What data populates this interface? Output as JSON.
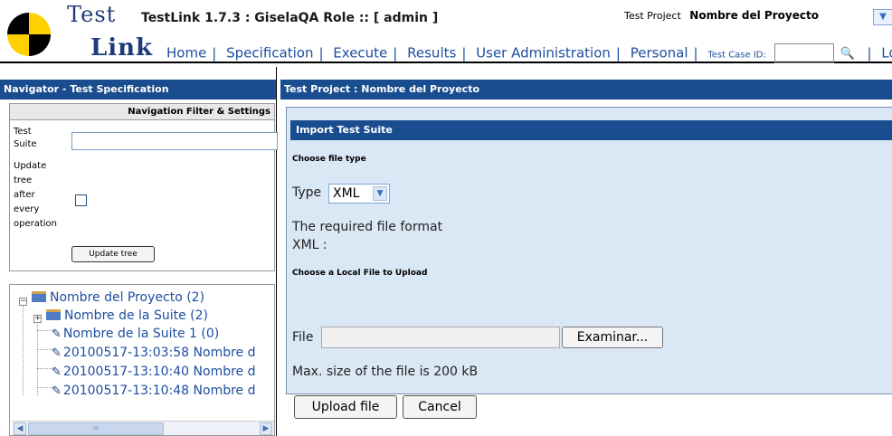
{
  "header": {
    "logo_word1": "Test",
    "logo_word2": "Link",
    "app_title": "TestLink 1.7.3 : GiselaQA Role :: [ admin ]",
    "test_project_label": "Test Project",
    "test_project_value": "Nombre del Proyecto"
  },
  "menu": {
    "items": [
      "Home",
      "Specification",
      "Execute",
      "Results",
      "User Administration",
      "Personal"
    ],
    "test_case_id_label": "Test Case ID:",
    "test_case_id_value": "",
    "logout": "Logout"
  },
  "navigator": {
    "title": "Navigator - Test Specification",
    "filter_title": "Navigation Filter & Settings",
    "test_suite_label": [
      "Test",
      "Suite"
    ],
    "test_suite_value": "",
    "update_label": [
      "Update",
      "tree",
      "after",
      "every",
      "operation"
    ],
    "update_checked": false,
    "update_button": "Update tree",
    "tree": [
      {
        "label": "Nombre del Proyecto (2)",
        "icon": "project-icon"
      },
      {
        "label": "Nombre de la Suite (2)",
        "icon": "folder-icon"
      },
      {
        "label": "Nombre de la Suite 1 (0)",
        "icon": "testcase-icon"
      },
      {
        "label": "20100517-13:03:58 Nombre d",
        "icon": "testcase-icon"
      },
      {
        "label": "20100517-13:10:40 Nombre d",
        "icon": "testcase-icon"
      },
      {
        "label": "20100517-13:10:48 Nombre d",
        "icon": "testcase-icon"
      }
    ],
    "scroll_thumb_label": "III"
  },
  "workframe": {
    "title": "Test Project : Nombre del Proyecto",
    "panel_title": "Import Test Suite",
    "choose_file_type": "Choose file type",
    "type_label": "Type",
    "type_value": "XML",
    "format_line1": "The required file format",
    "format_line2": "XML :",
    "choose_local_file": "Choose a Local File to Upload",
    "file_label": "File",
    "file_value": "",
    "browse_button": "Examinar...",
    "max_size": "Max. size of the file is 200 kB",
    "upload_button": "Upload file",
    "cancel_button": "Cancel"
  },
  "colors": {
    "titlebar": "#1a4d8f",
    "panel_bg": "#dae7f4",
    "link": "#1e4fa0"
  }
}
